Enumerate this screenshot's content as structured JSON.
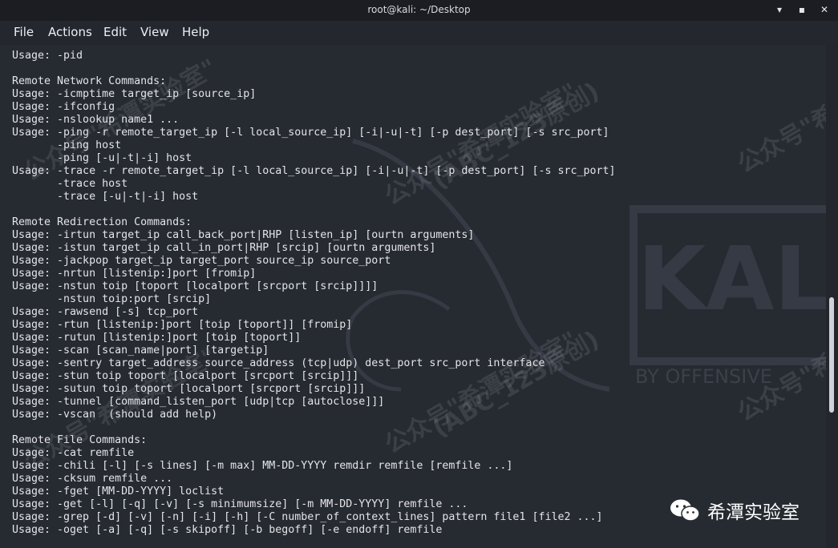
{
  "window": {
    "title": "root@kali: ~/Desktop",
    "controls": [
      "minimize-icon",
      "maximize-icon",
      "close-icon"
    ]
  },
  "menu": [
    "File",
    "Actions",
    "Edit",
    "View",
    "Help"
  ],
  "terminal": {
    "lines": [
      "Usage: -pid",
      "",
      "Remote Network Commands:",
      "Usage: -icmptime target_ip [source_ip]",
      "Usage: -ifconfig",
      "Usage: -nslookup name1 ...",
      "Usage: -ping -r remote_target_ip [-l local_source_ip] [-i|-u|-t] [-p dest_port] [-s src_port]",
      "       -ping host",
      "       -ping [-u|-t|-i] host",
      "Usage: -trace -r remote_target_ip [-l local_source_ip] [-i|-u|-t] [-p dest_port] [-s src_port]",
      "       -trace host",
      "       -trace [-u|-t|-i] host",
      "",
      "Remote Redirection Commands:",
      "Usage: -irtun target_ip call_back_port|RHP [listen_ip] [ourtn arguments]",
      "Usage: -istun target_ip call_in_port|RHP [srcip] [ourtn arguments]",
      "Usage: -jackpop target_ip target_port source_ip source_port",
      "Usage: -nrtun [listenip:]port [fromip]",
      "Usage: -nstun toip [toport [localport [srcport [srcip]]]]",
      "       -nstun toip:port [srcip]",
      "Usage: -rawsend [-s] tcp_port",
      "Usage: -rtun [listenip:]port [toip [toport]] [fromip]",
      "Usage: -rutun [listenip:]port [toip [toport]]",
      "Usage: -scan [scan_name|port] [targetip]",
      "Usage: -sentry target_address source_address (tcp|udp) dest_port src_port interface",
      "Usage: -stun toip toport [localport [srcport [srcip]]]",
      "Usage: -sutun toip toport [localport [srcport [srcip]]]",
      "Usage: -tunnel [command_listen_port [udp|tcp [autoclose]]]",
      "Usage: -vscan  (should add help)",
      "",
      "Remote File Commands:",
      "Usage: -cat remfile",
      "Usage: -chili [-l] [-s lines] [-m max] MM-DD-YYYY remdir remfile [remfile ...]",
      "Usage: -cksum remfile ...",
      "Usage: -fget [MM-DD-YYYY] loclist",
      "Usage: -get [-l] [-q] [-v] [-s minimumsize] [-m MM-DD-YYYY] remfile ...",
      "Usage: -grep [-d] [-v] [-n] [-i] [-h] [-C number_of_context_lines] pattern file1 [file2 ...]",
      "Usage: -oget [-a] [-q] [-s skipoff] [-b begoff] [-e endoff] remfile"
    ]
  },
  "background": {
    "logo_text": "KALI",
    "tagline": "BY OFFENSIVE"
  },
  "watermark": {
    "line1": "公众号\"希潭实验室\"",
    "line2": "(ABC_123原创)"
  },
  "badge": {
    "label": "希潭实验室"
  },
  "colors": {
    "terminal_bg": "#262a31",
    "titlebar_bg": "#1b1d22",
    "text": "#e3e5e8",
    "scroll_thumb": "#cfd3d8"
  }
}
